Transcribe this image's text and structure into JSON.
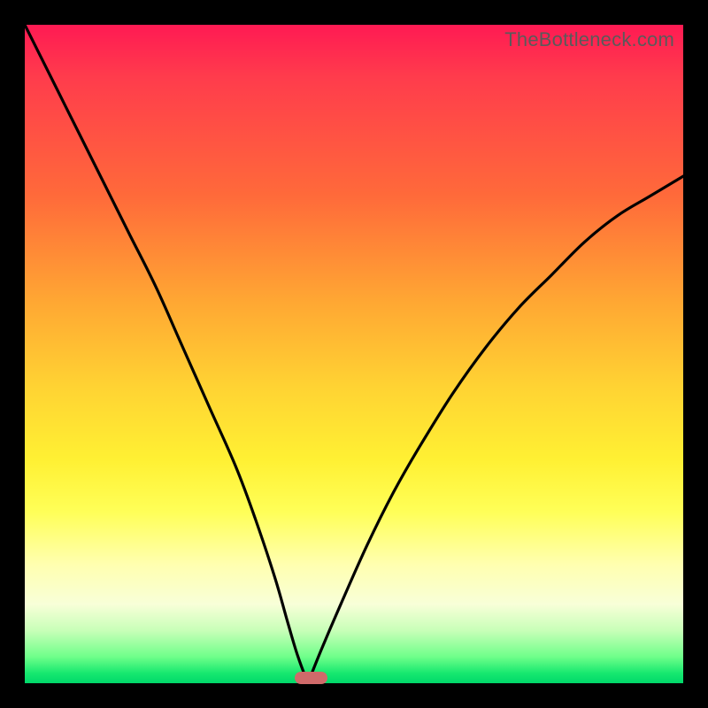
{
  "watermark": "TheBottleneck.com",
  "colors": {
    "frame": "#000000",
    "curve": "#000000",
    "marker": "#d06a6a",
    "gradient_stops": [
      {
        "pos": 0,
        "color": "#ff1a53"
      },
      {
        "pos": 8,
        "color": "#ff3c4c"
      },
      {
        "pos": 26,
        "color": "#ff6a3a"
      },
      {
        "pos": 42,
        "color": "#ffa733"
      },
      {
        "pos": 55,
        "color": "#ffd333"
      },
      {
        "pos": 66,
        "color": "#fff033"
      },
      {
        "pos": 74,
        "color": "#ffff58"
      },
      {
        "pos": 82,
        "color": "#ffffb0"
      },
      {
        "pos": 88,
        "color": "#f8ffd8"
      },
      {
        "pos": 92,
        "color": "#c8ffb8"
      },
      {
        "pos": 96,
        "color": "#6fff8a"
      },
      {
        "pos": 98.5,
        "color": "#16e86f"
      },
      {
        "pos": 100,
        "color": "#00d86a"
      }
    ]
  },
  "chart_data": {
    "type": "line",
    "title": "",
    "xlabel": "",
    "ylabel": "",
    "x_range": [
      0,
      100
    ],
    "y_range": [
      0,
      100
    ],
    "optimum_x": 43,
    "marker": {
      "x_start": 41,
      "x_end": 46,
      "y": 0
    },
    "series": [
      {
        "name": "left-branch",
        "x": [
          0,
          2,
          5,
          8,
          12,
          16,
          20,
          24,
          28,
          32,
          35,
          38,
          40,
          41.5,
          43
        ],
        "y": [
          100,
          96,
          90,
          84,
          76,
          68,
          60,
          51,
          42,
          33,
          25,
          16,
          9,
          4,
          0
        ]
      },
      {
        "name": "right-branch",
        "x": [
          43,
          45,
          48,
          52,
          56,
          60,
          65,
          70,
          75,
          80,
          85,
          90,
          95,
          100
        ],
        "y": [
          0,
          5,
          12,
          21,
          29,
          36,
          44,
          51,
          57,
          62,
          67,
          71,
          74,
          77
        ]
      }
    ]
  }
}
